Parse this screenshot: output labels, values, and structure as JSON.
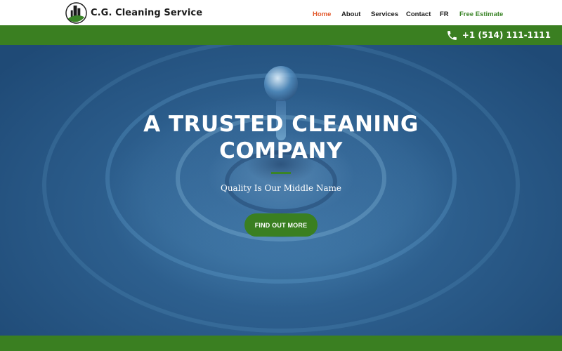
{
  "brand": {
    "name": "C.G. Cleaning Service",
    "logo_icon": "building-leaf-logo"
  },
  "nav": {
    "items": [
      {
        "label": "Home",
        "state": "active"
      },
      {
        "label": "About"
      },
      {
        "label": "Services"
      },
      {
        "label": "Contact"
      },
      {
        "label": "FR"
      },
      {
        "label": "Free Estimate",
        "state": "highlight"
      }
    ]
  },
  "contact": {
    "phone": "+1 (514) 111-1111",
    "icon": "phone-icon"
  },
  "hero": {
    "title_line1": "A TRUSTED CLEANING",
    "title_line2": "COMPANY",
    "subtitle": "Quality Is Our Middle Name",
    "cta_label": "FIND OUT MORE",
    "background": "water-drop-photo"
  },
  "colors": {
    "accent_green": "#3a7f21",
    "active_nav": "#e2592c",
    "highlight_nav": "#3a8427"
  }
}
